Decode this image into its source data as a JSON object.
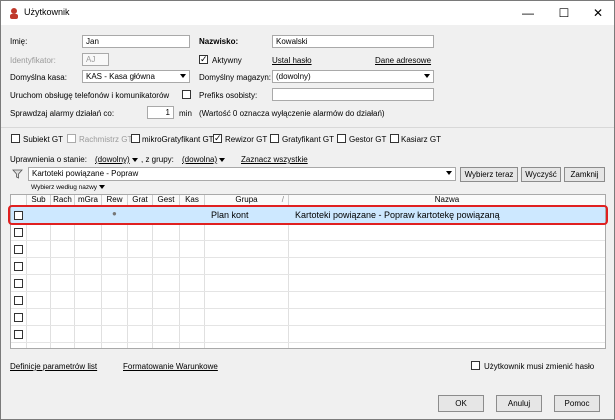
{
  "window": {
    "title": "Użytkownik",
    "minimize": "—",
    "maximize": "☐",
    "close": "✕"
  },
  "form": {
    "imie_label": "Imię:",
    "imie_value": "Jan",
    "nazwisko_label": "Nazwisko:",
    "nazwisko_value": "Kowalski",
    "identyfikator_label": "Identyfikator:",
    "identyfikator_value": "AJ",
    "aktywny_label": "Aktywny",
    "aktywny_checked": true,
    "ustal_haslo": "Ustal hasło",
    "dane_adresowe": "Dane adresowe",
    "kasa_label": "Domyślna kasa:",
    "kasa_value": "KAS - Kasa główna",
    "magazyn_label": "Domyślny magazyn:",
    "magazyn_value": "(dowolny)",
    "komunikatory_label": "Uruchom obsługę telefonów i komunikatorów",
    "prefiks_label": "Prefiks osobisty:",
    "prefiks_value": "",
    "alarmy_label": "Sprawdzaj alarmy działań co:",
    "alarmy_value": "1",
    "alarmy_unit": "min",
    "alarmy_note": "(Wartość 0 oznacza wyłączenie alarmów do działań)"
  },
  "roles": [
    {
      "label": "Subiekt GT",
      "checked": false,
      "disabled": false
    },
    {
      "label": "Rachmistrz GT",
      "checked": false,
      "disabled": true
    },
    {
      "label": "mikroGratyfikant GT",
      "checked": false,
      "disabled": false
    },
    {
      "label": "Rewizor GT",
      "checked": true,
      "disabled": false
    },
    {
      "label": "Gratyfikant GT",
      "checked": false,
      "disabled": false
    },
    {
      "label": "Gestor GT",
      "checked": false,
      "disabled": false
    },
    {
      "label": "Kasiarz GT",
      "checked": false,
      "disabled": false
    }
  ],
  "permissions": {
    "stan_label": "Uprawnienia o stanie:",
    "stan_value": "(dowolny)",
    "grupa_label": ", z grupy:",
    "grupa_value": "(dowolna)",
    "zaznacz_wszystkie": "Zaznacz wszystkie",
    "selector_value": "Kartoteki powiązane - Popraw",
    "wybierz_teraz": "Wybierz teraz",
    "wyczysc": "Wyczyść",
    "zamknij": "Zamknij",
    "wybierz_wedlug": "Wybierz według nazwy"
  },
  "grid": {
    "columns": [
      "Sub",
      "Rach",
      "mGra",
      "Rew",
      "Grat",
      "Gest",
      "Kas",
      "Grupa",
      "Nazwa"
    ],
    "sort_indicator": "/",
    "rows": [
      {
        "grupa": "Plan kont",
        "nazwa": "Kartoteki powiązane - Popraw kartotekę powiązaną",
        "rew_dot": "●"
      }
    ],
    "empty_rows": 8
  },
  "footer": {
    "definicje": "Definicje parametrów list",
    "formatowanie": "Formatowanie Warunkowe",
    "musi_zmienic": "Użytkownik musi zmienić hasło",
    "ok": "OK",
    "anuluj": "Anuluj",
    "pomoc": "Pomoc"
  }
}
